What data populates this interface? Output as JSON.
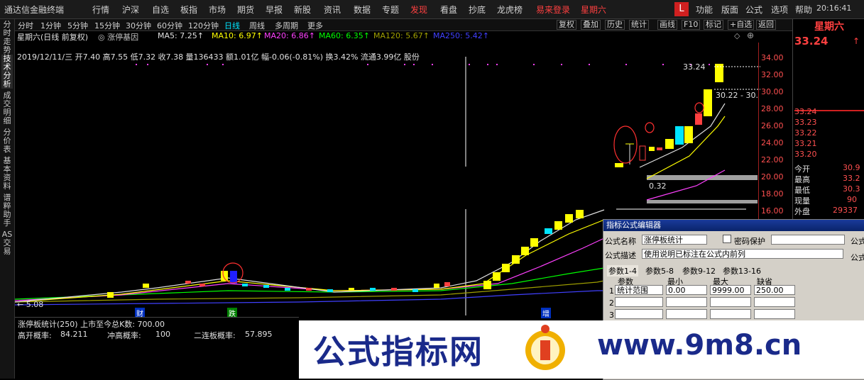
{
  "menu": [
    "通达信金融终端",
    "行情",
    "沪深",
    "自选",
    "板指",
    "市场",
    "期货",
    "早报",
    "新股",
    "资讯",
    "数据",
    "专题",
    "发现",
    "看盘",
    "抄底",
    "龙虎榜",
    "易来登录",
    "星期六"
  ],
  "menu_right": [
    "功能",
    "版面",
    "公式",
    "选项",
    "帮助"
  ],
  "logo_glyph": "L",
  "clock": "20:16:41",
  "left_tabs": [
    "分时走势",
    "技术分析",
    "成交明细",
    "分价表",
    "基本资料",
    "谱粹助手",
    "AS交易"
  ],
  "periods": [
    "分时",
    "1分钟",
    "5分钟",
    "15分钟",
    "30分钟",
    "60分钟",
    "120分钟",
    "日线",
    "周线",
    "多周期",
    "更多"
  ],
  "toolbar": [
    "复权",
    "叠加",
    "历史",
    "统计",
    "画线",
    "F10",
    "标记",
    "+自选",
    "返回"
  ],
  "header": {
    "title": "星期六(日线 前复权)",
    "badge": "涨停基因",
    "ma": [
      {
        "text": "MA5: 7.25↑",
        "color": "#e0e0e0"
      },
      {
        "text": "MA10: 6.97↑",
        "color": "#ffff00"
      },
      {
        "text": "MA20: 6.86↑",
        "color": "#ff40ff"
      },
      {
        "text": "MA60: 6.35↑",
        "color": "#00ff00"
      },
      {
        "text": "MA120: 5.67↑",
        "color": "#a0a000"
      },
      {
        "text": "MA250: 5.42↑",
        "color": "#4040ff"
      }
    ],
    "info": "2019/12/11/三 开7.40 高7.55 低7.32 收7.38 量136433 额1.01亿 幅-0.06(-0.81%) 换3.42% 流通3.99亿 股份"
  },
  "chart_labels": {
    "high_label": "33.24",
    "mid_label": "30.22 - 30.",
    "low_label": "0.32",
    "min_label": "← 5.08",
    "event_markers": [
      "财",
      "跌",
      "增"
    ]
  },
  "y_ticks": [
    "34.00",
    "32.00",
    "30.00",
    "28.00",
    "26.00",
    "24.00",
    "22.00",
    "20.00",
    "18.00",
    "16.00"
  ],
  "chart_data": {
    "type": "candlestick",
    "title": "星期六(日线 前复权)",
    "price_range": [
      5.08,
      33.24
    ],
    "y_ticks": [
      34,
      32,
      30,
      28,
      26,
      24,
      22,
      20,
      18,
      16
    ],
    "ma_values": {
      "MA5": 7.25,
      "MA10": 6.97,
      "MA20": 6.86,
      "MA60": 6.35,
      "MA120": 5.67,
      "MA250": 5.42
    },
    "last_price": 33.24
  },
  "right_panel": {
    "name": "星期六",
    "price": "33.24",
    "order_prices": [
      "33.24",
      "33.23",
      "33.22",
      "33.21",
      "33.20"
    ],
    "stats": [
      {
        "label": "今开",
        "value": "30.9"
      },
      {
        "label": "最高",
        "value": "33.2"
      },
      {
        "label": "最低",
        "value": "30.3"
      },
      {
        "label": "现量",
        "value": "90"
      },
      {
        "label": "外盘",
        "value": "29337"
      }
    ]
  },
  "dialog": {
    "title": "指标公式编辑器",
    "name_label": "公式名称",
    "name_value": "涨停板统计",
    "password_label": "密码保护",
    "desc_label": "公式描述",
    "desc_value": "使用说明已标注在公式内前列",
    "right_label_1": "公式",
    "right_label_2": "公式",
    "tabs": [
      "参数1-4",
      "参数5-8",
      "参数9-12",
      "参数13-16"
    ],
    "columns": [
      "参数",
      "最小",
      "最大",
      "缺省"
    ],
    "rows": [
      {
        "idx": "1",
        "name": "统计范围",
        "min": "0.00",
        "max": "9999.00",
        "def": "250.00"
      },
      {
        "idx": "2",
        "name": "",
        "min": "",
        "max": "",
        "def": ""
      },
      {
        "idx": "3",
        "name": "",
        "min": "",
        "max": "",
        "def": ""
      }
    ]
  },
  "indicator": {
    "title": "涨停板统计(250) 上市至今总K数: 700.00",
    "items": [
      {
        "label": "高开概率:",
        "value": "84.211"
      },
      {
        "label": "冲高概率:",
        "value": "100"
      },
      {
        "label": "二连板概率:",
        "value": "57.895"
      }
    ]
  },
  "watermark": {
    "text": "公式指标网",
    "url": "www.9m8.cn"
  }
}
